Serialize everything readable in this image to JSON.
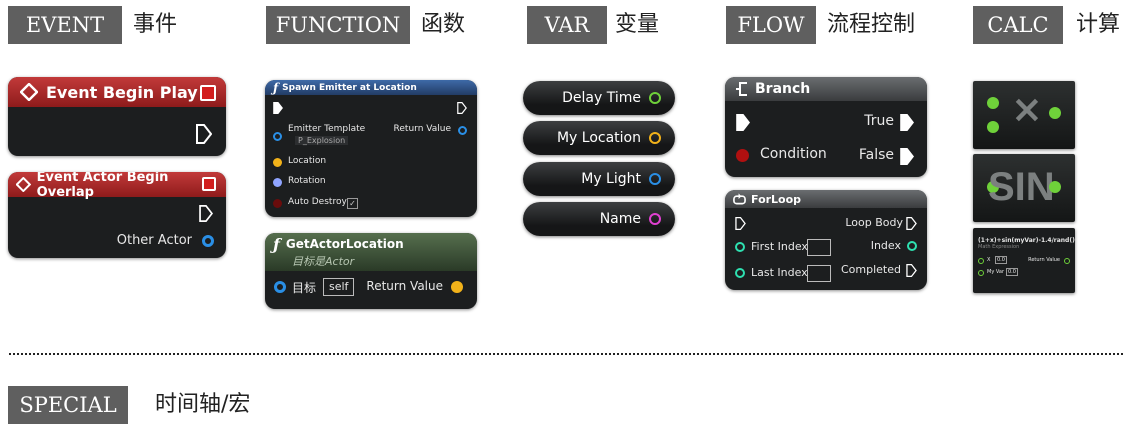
{
  "categories": [
    {
      "tag": "EVENT",
      "cn": "事件"
    },
    {
      "tag": "FUNCTION",
      "cn": "函数"
    },
    {
      "tag": "VAR",
      "cn": "变量"
    },
    {
      "tag": "FLOW",
      "cn": "流程控制"
    },
    {
      "tag": "CALC",
      "cn": "计算"
    }
  ],
  "special": {
    "tag": "SPECIAL",
    "cn": "时间轴/宏"
  },
  "event_begin_play": {
    "title": "Event Begin Play"
  },
  "event_overlap": {
    "title": "Event Actor Begin Overlap",
    "pin_label": "Other Actor"
  },
  "spawn_emitter": {
    "title": "Spawn Emitter at Location",
    "emitter_template_label": "Emitter Template",
    "emitter_template_value": "P_Explosion",
    "return_value_label": "Return Value",
    "location_label": "Location",
    "rotation_label": "Rotation",
    "auto_destroy_label": "Auto Destroy"
  },
  "get_actor_location": {
    "title": "GetActorLocation",
    "subtitle": "目标是Actor",
    "target_label": "目标",
    "target_value": "self",
    "return_value_label": "Return Value"
  },
  "variables": [
    {
      "label": "Delay Time",
      "color": "#6fd13a"
    },
    {
      "label": "My Location",
      "color": "#f2b21a"
    },
    {
      "label": "My Light",
      "color": "#2a8fe6"
    },
    {
      "label": "Name",
      "color": "#e040d0"
    }
  ],
  "branch": {
    "title": "Branch",
    "true_label": "True",
    "condition_label": "Condition",
    "false_label": "False"
  },
  "for_loop": {
    "title": "ForLoop",
    "loop_body_label": "Loop Body",
    "first_index_label": "First Index",
    "index_label": "Index",
    "last_index_label": "Last Index",
    "completed_label": "Completed"
  },
  "calc": {
    "multiply_symbol": "×",
    "sin_label": "SIN",
    "expression_title": "(1+x)+sin(myVar)-1.4/rand()",
    "expression_subtitle": "Math Expression",
    "x_label": "X",
    "x_value": "0.0",
    "myvar_label": "My Var",
    "myvar_value": "0.0",
    "return_value_label": "Return Value"
  },
  "colors": {
    "tag_bg": "#5f5f5f",
    "float_green": "#6fd13a",
    "vector_yellow": "#f2b21a",
    "rotator_blue": "#8fa4ff",
    "object_blue": "#2a8fe6",
    "bool_red": "#b01010",
    "int_teal": "#2ee0b0",
    "name_magenta": "#e040d0",
    "event_red": "#c23a3a"
  }
}
